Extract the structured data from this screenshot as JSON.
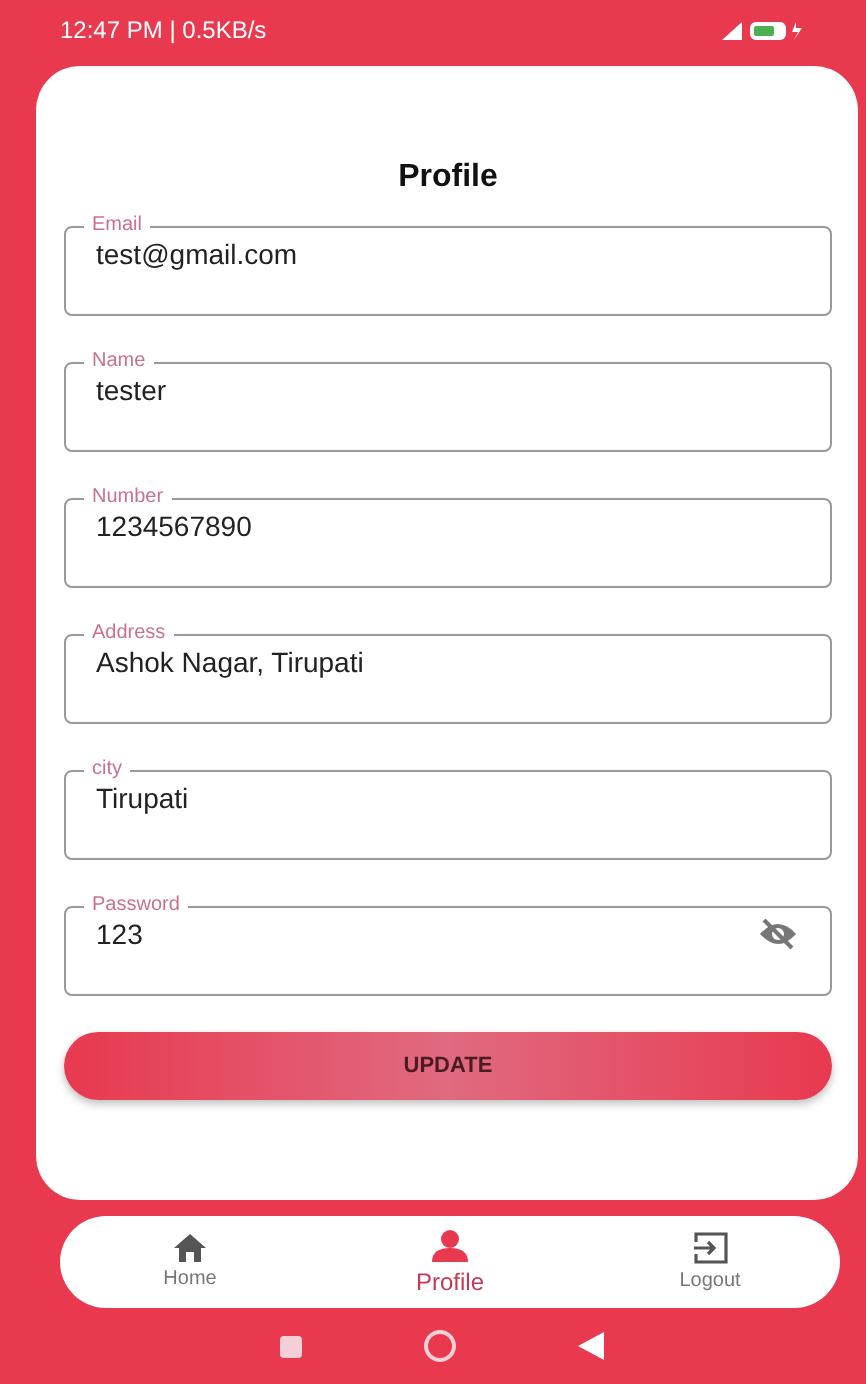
{
  "status_bar": {
    "time": "12:47 PM | 0.5KB/s"
  },
  "title": "Profile",
  "fields": [
    {
      "kind": "text",
      "label": "Email",
      "value": "test@gmail.com"
    },
    {
      "kind": "text",
      "label": "Name",
      "value": "tester"
    },
    {
      "kind": "text",
      "label": "Number",
      "value": "1234567890"
    },
    {
      "kind": "text",
      "label": "Address",
      "value": "Ashok Nagar, Tirupati"
    },
    {
      "kind": "text",
      "label": "city",
      "value": "Tirupati"
    },
    {
      "kind": "password",
      "label": "Password",
      "value": "123"
    }
  ],
  "button": "UPDATE",
  "nav": [
    {
      "kind": "home",
      "label": "Home",
      "selected": false
    },
    {
      "kind": "profile",
      "label": "Profile",
      "selected": true
    },
    {
      "kind": "logout",
      "label": "Logout",
      "selected": false
    }
  ]
}
